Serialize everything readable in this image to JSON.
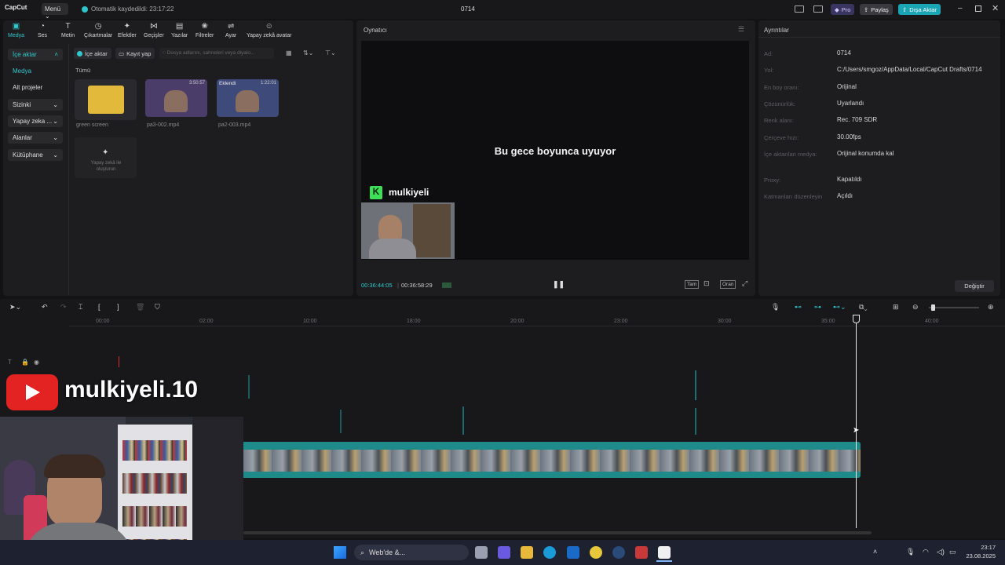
{
  "titlebar": {
    "logo": "CapCut",
    "menu_label": "Menü",
    "autosave": "Otomatik kaydedildi: 23:17:22",
    "title": "0714",
    "pro_label": "Pro",
    "share_label": "Paylaş",
    "export_label": "Dışa Aktar"
  },
  "toolbar": {
    "items": [
      {
        "label": "Medya",
        "icon": "media-icon"
      },
      {
        "label": "Ses",
        "icon": "audio-icon"
      },
      {
        "label": "Metin",
        "icon": "text-icon"
      },
      {
        "label": "Çıkartmalar",
        "icon": "sticker-icon"
      },
      {
        "label": "Efektler",
        "icon": "effects-icon"
      },
      {
        "label": "Geçişler",
        "icon": "transitions-icon"
      },
      {
        "label": "Yazılar",
        "icon": "captions-icon"
      },
      {
        "label": "Filtreler",
        "icon": "filters-icon"
      },
      {
        "label": "Ayar",
        "icon": "adjust-icon"
      },
      {
        "label": "Yapay zekâ avatar",
        "icon": "ai-avatar-icon"
      }
    ]
  },
  "sidebar": {
    "items": [
      {
        "label": "İçe aktar"
      },
      {
        "label": "Medya"
      },
      {
        "label": "Alt projeler"
      },
      {
        "label": "Sizinki"
      },
      {
        "label": "Yapay zeka ..."
      },
      {
        "label": "Alanlar"
      },
      {
        "label": "Kütüphane"
      }
    ]
  },
  "media": {
    "import_button": "İçe aktar",
    "record_button": "Kayıt yap",
    "search_placeholder": "Dosya adlarını, sahneleri veya diyalo...",
    "section_label": "Tümü",
    "items": [
      {
        "name": "green screen",
        "duration": ""
      },
      {
        "name": "pa3-002.mp4",
        "duration": "3:50:57"
      },
      {
        "name": "pa2-003.mp4",
        "duration": "1:22:01",
        "badge": "Eklendi"
      }
    ],
    "ai_create_label": "Yapay zekâ ile oluşturun"
  },
  "player": {
    "title": "Oynatıcı",
    "subtitle_text": "Bu gece boyunca uyuyor",
    "overlay_name": "mulkiyeli",
    "current_time": "00:36:44:05",
    "total_time": "00:36:58:29",
    "full_label": "Tam",
    "ratio_label": "Oran"
  },
  "details": {
    "title": "Ayrıntılar",
    "rows": [
      {
        "label": "Ad:",
        "value": "0714"
      },
      {
        "label": "Yol:",
        "value": "C:/Users/smgoz/AppData/Local/CapCut Drafts/0714"
      },
      {
        "label": "En boy oranı:",
        "value": "Orijinal"
      },
      {
        "label": "Çözünürlük:",
        "value": "Uyarlandı"
      },
      {
        "label": "Renk alanı:",
        "value": "Rec. 709 SDR"
      },
      {
        "label": "Çerçeve hızı:",
        "value": "30.00fps"
      },
      {
        "label": "İçe aktarılan medya:",
        "value": "Orijinal konumda kal"
      },
      {
        "label": "Proxy:",
        "value": "Kapatıldı"
      },
      {
        "label": "Katmanları düzenleyin",
        "value": "Açıldı"
      }
    ],
    "modify_button": "Değiştir"
  },
  "timeline": {
    "ruler": [
      "00:00",
      "02:00",
      "10:00",
      "18:00",
      "20:00",
      "23:00",
      "30:00",
      "35:00",
      "40:00"
    ]
  },
  "webcam_overlay": {
    "channel": "mulkiyeli.10"
  },
  "taskbar": {
    "search_label": "Web'de &...",
    "time": "23:17",
    "date": "23.08.2025"
  },
  "colors": {
    "accent": "#2fc8cc",
    "export": "#1aa5b5",
    "track": "#1e8a8a"
  }
}
